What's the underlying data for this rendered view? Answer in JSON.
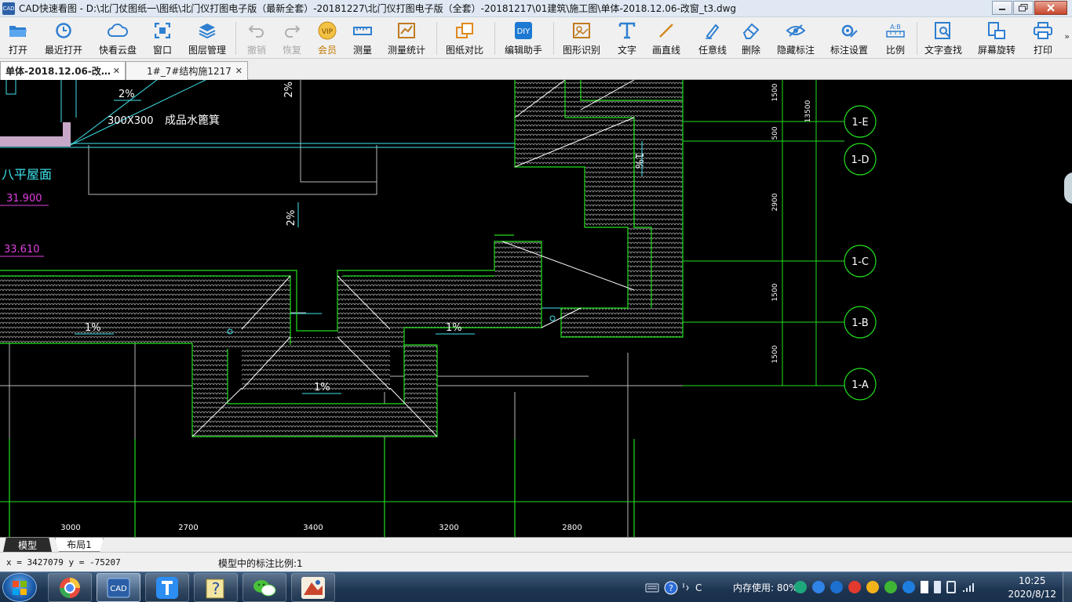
{
  "window": {
    "icon_text": "CAD",
    "title": "CAD快速看图 - D:\\北门仗图纸一\\图纸\\北门仪打图电子版（最新全套）-20181227\\北门仪打图电子版（全套）-20181217\\01建筑\\施工图\\单体-2018.12.06-改窗_t3.dwg"
  },
  "toolbar": {
    "items": [
      {
        "label": "打开",
        "icon": "folder-open-icon"
      },
      {
        "label": "最近打开",
        "icon": "history-icon"
      },
      {
        "label": "快看云盘",
        "icon": "cloud-icon"
      },
      {
        "label": "窗口",
        "icon": "window-icon"
      },
      {
        "label": "图层管理",
        "icon": "layers-icon"
      },
      {
        "label": "撤销",
        "icon": "undo-icon",
        "disabled": true
      },
      {
        "label": "恢复",
        "icon": "redo-icon",
        "disabled": true
      },
      {
        "label": "会员",
        "icon": "vip-icon"
      },
      {
        "label": "测量",
        "icon": "ruler-icon"
      },
      {
        "label": "测量统计",
        "icon": "measure-stats-icon"
      },
      {
        "label": "图纸对比",
        "icon": "compare-icon"
      },
      {
        "label": "编辑助手",
        "icon": "edit-helper-icon"
      },
      {
        "label": "图形识别",
        "icon": "shape-recognize-icon"
      },
      {
        "label": "文字",
        "icon": "text-icon"
      },
      {
        "label": "画直线",
        "icon": "line-icon"
      },
      {
        "label": "任意线",
        "icon": "pen-icon"
      },
      {
        "label": "删除",
        "icon": "eraser-icon"
      },
      {
        "label": "隐藏标注",
        "icon": "eye-hide-icon"
      },
      {
        "label": "标注设置",
        "icon": "annotation-settings-icon"
      },
      {
        "label": "比例",
        "icon": "scale-icon"
      },
      {
        "label": "文字查找",
        "icon": "text-search-icon"
      },
      {
        "label": "屏幕旋转",
        "icon": "rotate-screen-icon"
      },
      {
        "label": "打印",
        "icon": "print-icon"
      }
    ],
    "more": "»"
  },
  "tabs": [
    {
      "label": "单体-2018.12.06-改…",
      "close": "✕",
      "active": true
    },
    {
      "label": "1#_7#结构施1217",
      "close": "✕",
      "active": false
    }
  ],
  "drawing": {
    "colors": {
      "green": "#22e01e",
      "cyan": "#3fe3ee",
      "white": "#ffffff",
      "magenta": "#e040e0",
      "gray": "#b9b9b9"
    },
    "texts": {
      "slope_2pct": "2%",
      "size_label": "300X300",
      "fixture_label": "成品水篦箕",
      "roof_label": "八平屋面",
      "elev_1": "31.900",
      "elev_2": "33.610",
      "slope_1pct": "1%",
      "slope_2pct_b": "2%"
    },
    "axes": [
      {
        "label": "1-E"
      },
      {
        "label": "1-D"
      },
      {
        "label": "1-C"
      },
      {
        "label": "1-B"
      },
      {
        "label": "1-A"
      }
    ],
    "vertical_dims": [
      "1500",
      "500",
      "2900",
      "1500",
      "1500"
    ],
    "overall_dim": "13500",
    "bottom_dims": [
      "3000",
      "2700",
      "3400",
      "3200",
      "2800"
    ]
  },
  "layout_tabs": [
    {
      "label": "模型",
      "active": true
    },
    {
      "label": "布局1",
      "active": false
    }
  ],
  "status": {
    "coords": "x = 3427079  y = -75207",
    "scale_text": "模型中的标注比例:1"
  },
  "taskbar": {
    "apps": [
      "browser-app",
      "cad-app",
      "tencent-doc-app",
      "help-app",
      "wechat-app",
      "photo-app"
    ],
    "tray_letter": "C",
    "memory": "内存使用: 80%",
    "time": "10:25",
    "date": "2020/8/12"
  }
}
